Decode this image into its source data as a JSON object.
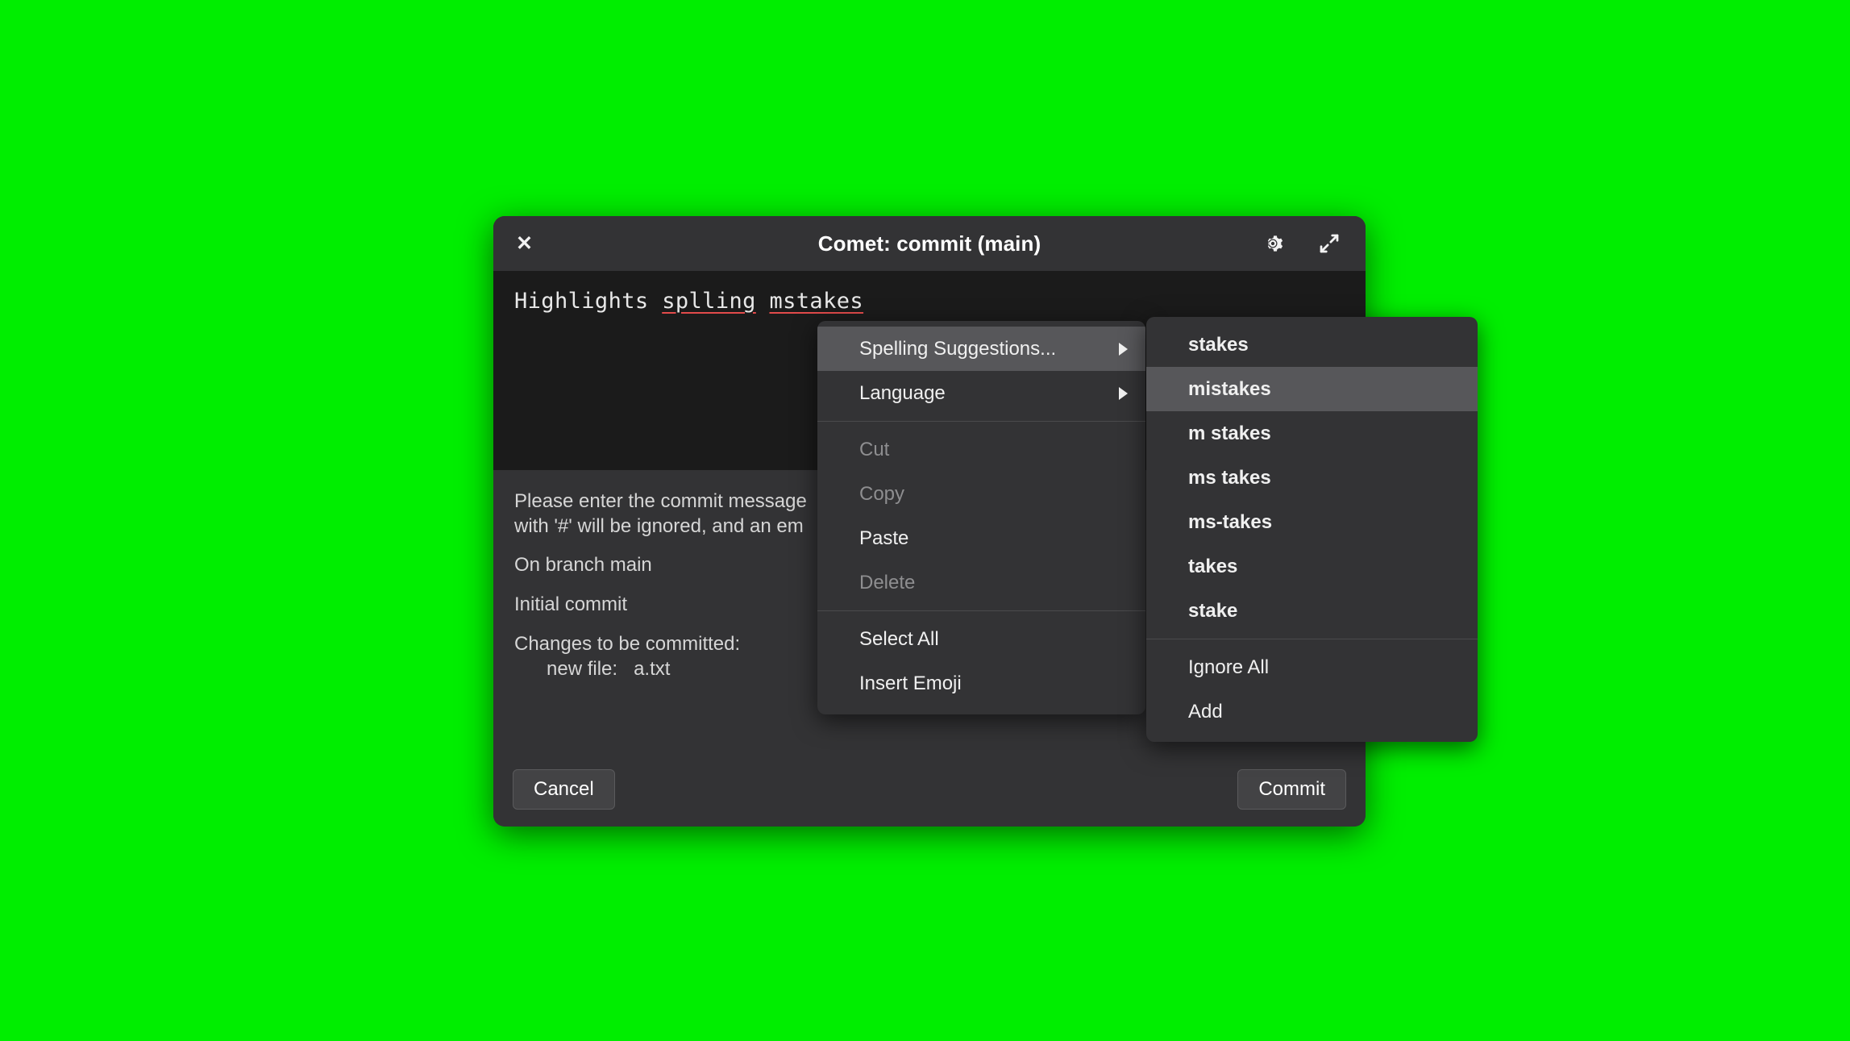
{
  "window": {
    "title": "Comet: commit (main)",
    "close_icon": "close-x-icon",
    "settings_icon": "gear-icon",
    "expand_icon": "expand-diagonal-arrows-icon"
  },
  "editor": {
    "text_before": "Highlights ",
    "misspelled_1": "splling",
    "text_middle": " ",
    "misspelled_2": "mstakes"
  },
  "body": {
    "line_1": "Please enter the commit message",
    "line_2": "with '#' will be ignored, and an em",
    "line_3": "On branch main",
    "line_4": "Initial commit",
    "line_5": "Changes to be committed:",
    "line_6": "      new file:   a.txt"
  },
  "footer": {
    "cancel_label": "Cancel",
    "commit_label": "Commit"
  },
  "context_menu": {
    "items": [
      {
        "label": "Spelling Suggestions...",
        "submenu": true,
        "disabled": false,
        "highlighted": true
      },
      {
        "label": "Language",
        "submenu": true,
        "disabled": false,
        "highlighted": false
      },
      {
        "label": "Cut",
        "submenu": false,
        "disabled": true,
        "highlighted": false
      },
      {
        "label": "Copy",
        "submenu": false,
        "disabled": true,
        "highlighted": false
      },
      {
        "label": "Paste",
        "submenu": false,
        "disabled": false,
        "highlighted": false
      },
      {
        "label": "Delete",
        "submenu": false,
        "disabled": true,
        "highlighted": false
      },
      {
        "label": "Select All",
        "submenu": false,
        "disabled": false,
        "highlighted": false
      },
      {
        "label": "Insert Emoji",
        "submenu": false,
        "disabled": false,
        "highlighted": false
      }
    ]
  },
  "spelling_submenu": {
    "suggestions": [
      {
        "label": "stakes",
        "highlighted": false
      },
      {
        "label": "mistakes",
        "highlighted": true
      },
      {
        "label": "m stakes",
        "highlighted": false
      },
      {
        "label": "ms takes",
        "highlighted": false
      },
      {
        "label": "ms-takes",
        "highlighted": false
      },
      {
        "label": "takes",
        "highlighted": false
      },
      {
        "label": "stake",
        "highlighted": false
      }
    ],
    "actions": [
      {
        "label": "Ignore All"
      },
      {
        "label": "Add"
      }
    ]
  },
  "colors": {
    "background": "#00ee00",
    "dialog": "#333335",
    "editor": "#1b1b1b",
    "highlight": "#57575a",
    "spellcheck_underline": "#e24b4b"
  }
}
